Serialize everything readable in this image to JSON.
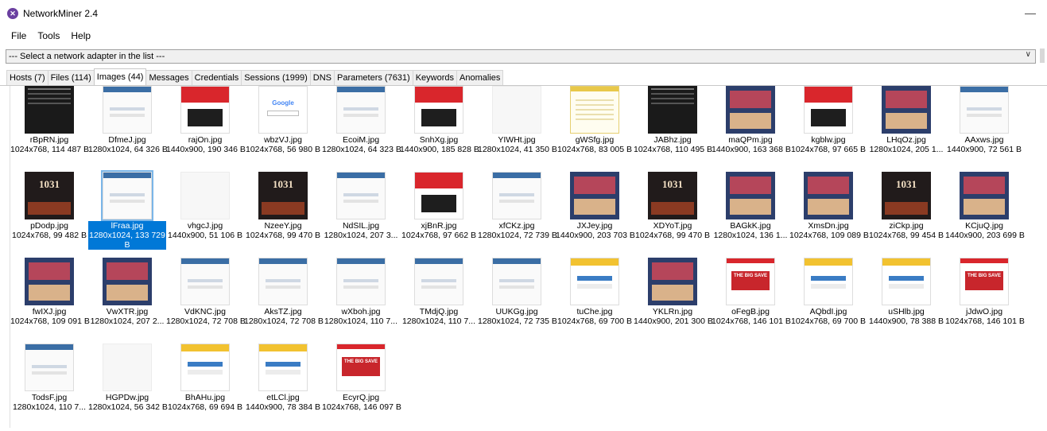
{
  "window": {
    "title": "NetworkMiner 2.4",
    "minimize_glyph": "—"
  },
  "menu": [
    "File",
    "Tools",
    "Help"
  ],
  "adapter": {
    "value": "--- Select a network adapter in the list ---"
  },
  "tabs": [
    "Hosts (7)",
    "Files (114)",
    "Images (44)",
    "Messages",
    "Credentials",
    "Sessions (1999)",
    "DNS",
    "Parameters (7631)",
    "Keywords",
    "Anomalies"
  ],
  "active_tab": "Images (44)",
  "images": [
    {
      "name": "rBpRN.jpg",
      "info": "1024x768, 114 487 B",
      "style": "dark"
    },
    {
      "name": "DfmeJ.jpg",
      "info": "1280x1024, 64 326 B",
      "style": "web"
    },
    {
      "name": "rajOn.jpg",
      "info": "1440x900, 190 346 B",
      "style": "red"
    },
    {
      "name": "wbzVJ.jpg",
      "info": "1024x768, 56 980 B",
      "style": "google"
    },
    {
      "name": "EcoiM.jpg",
      "info": "1280x1024, 64 323 B",
      "style": "web"
    },
    {
      "name": "SnhXg.jpg",
      "info": "1440x900, 185 828 B",
      "style": "red"
    },
    {
      "name": "YIWHt.jpg",
      "info": "1280x1024, 41 350 B",
      "style": "blank"
    },
    {
      "name": "gWSfg.jpg",
      "info": "1024x768, 83 005 B",
      "style": "yellow"
    },
    {
      "name": "JABhz.jpg",
      "info": "1024x768, 110 495 B",
      "style": "dark"
    },
    {
      "name": "maQPm.jpg",
      "info": "1440x900, 163 368 B",
      "style": "photo"
    },
    {
      "name": "kgblw.jpg",
      "info": "1024x768, 97 665 B",
      "style": "red"
    },
    {
      "name": "LHqOz.jpg",
      "info": "1280x1024, 205 1...",
      "style": "photo"
    },
    {
      "name": "AAxws.jpg",
      "info": "1440x900, 72 561 B",
      "style": "web"
    },
    {
      "name": "pDodp.jpg",
      "info": "1024x768, 99 482 B",
      "style": "movie"
    },
    {
      "name": "lFraa.jpg",
      "info": "1280x1024, 133 729 B",
      "style": "web",
      "selected": true
    },
    {
      "name": "vhgcJ.jpg",
      "info": "1440x900, 51 106 B",
      "style": "blank"
    },
    {
      "name": "NzeeY.jpg",
      "info": "1024x768, 99 470 B",
      "style": "movie"
    },
    {
      "name": "NdSIL.jpg",
      "info": "1280x1024, 207 3...",
      "style": "web"
    },
    {
      "name": "xjBnR.jpg",
      "info": "1024x768, 97 662 B",
      "style": "red"
    },
    {
      "name": "xfCKz.jpg",
      "info": "1280x1024, 72 739 B",
      "style": "web"
    },
    {
      "name": "JXJey.jpg",
      "info": "1440x900, 203 703 B",
      "style": "photo"
    },
    {
      "name": "XDYoT.jpg",
      "info": "1024x768, 99 470 B",
      "style": "movie"
    },
    {
      "name": "BAGkK.jpg",
      "info": "1280x1024, 136 1...",
      "style": "photo"
    },
    {
      "name": "XmsDn.jpg",
      "info": "1024x768, 109 089 B",
      "style": "photo"
    },
    {
      "name": "ziCkp.jpg",
      "info": "1024x768, 99 454 B",
      "style": "movie"
    },
    {
      "name": "KCjuQ.jpg",
      "info": "1440x900, 203 699 B",
      "style": "photo"
    },
    {
      "name": "fwIXJ.jpg",
      "info": "1024x768, 109 091 B",
      "style": "photo"
    },
    {
      "name": "VwXTR.jpg",
      "info": "1280x1024, 207 2...",
      "style": "photo"
    },
    {
      "name": "VdKNC.jpg",
      "info": "1280x1024, 72 708 B",
      "style": "web"
    },
    {
      "name": "AksTZ.jpg",
      "info": "1280x1024, 72 708 B",
      "style": "web"
    },
    {
      "name": "wXboh.jpg",
      "info": "1280x1024, 110 7...",
      "style": "web"
    },
    {
      "name": "TMdjQ.jpg",
      "info": "1280x1024, 110 7...",
      "style": "web"
    },
    {
      "name": "UUKGg.jpg",
      "info": "1280x1024, 72 735 B",
      "style": "web"
    },
    {
      "name": "tuChe.jpg",
      "info": "1024x768, 69 700 B",
      "style": "yellowbar"
    },
    {
      "name": "YKLRn.jpg",
      "info": "1440x900, 201 300 B",
      "style": "photo"
    },
    {
      "name": "oFegB.jpg",
      "info": "1024x768, 146 101 B",
      "style": "big"
    },
    {
      "name": "AQbdI.jpg",
      "info": "1024x768, 69 700 B",
      "style": "yellowbar"
    },
    {
      "name": "uSHlb.jpg",
      "info": "1440x900, 78 388 B",
      "style": "yellowbar"
    },
    {
      "name": "jJdwO.jpg",
      "info": "1024x768, 146 101 B",
      "style": "big"
    },
    {
      "name": "TodsF.jpg",
      "info": "1280x1024, 110 7...",
      "style": "web"
    },
    {
      "name": "HGPDw.jpg",
      "info": "1280x1024, 56 342 B",
      "style": "blank"
    },
    {
      "name": "BhAHu.jpg",
      "info": "1024x768, 69 694 B",
      "style": "yellowbar"
    },
    {
      "name": "etLCl.jpg",
      "info": "1440x900, 78 384 B",
      "style": "yellowbar"
    },
    {
      "name": "EcyrQ.jpg",
      "info": "1024x768, 146 097 B",
      "style": "big"
    }
  ]
}
